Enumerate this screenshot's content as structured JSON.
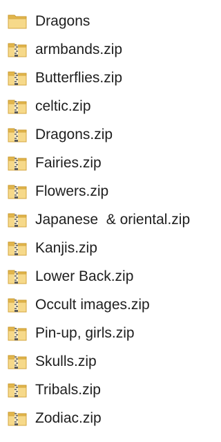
{
  "folder_view": {
    "items": [
      {
        "name": "Dragons",
        "type": "folder",
        "icon": "folder-icon"
      },
      {
        "name": "armbands.zip",
        "type": "zip",
        "icon": "zip-folder-icon"
      },
      {
        "name": "Butterflies.zip",
        "type": "zip",
        "icon": "zip-folder-icon"
      },
      {
        "name": "celtic.zip",
        "type": "zip",
        "icon": "zip-folder-icon"
      },
      {
        "name": "Dragons.zip",
        "type": "zip",
        "icon": "zip-folder-icon"
      },
      {
        "name": "Fairies.zip",
        "type": "zip",
        "icon": "zip-folder-icon"
      },
      {
        "name": "Flowers.zip",
        "type": "zip",
        "icon": "zip-folder-icon"
      },
      {
        "name": "Japanese  & oriental.zip",
        "type": "zip",
        "icon": "zip-folder-icon"
      },
      {
        "name": "Kanjis.zip",
        "type": "zip",
        "icon": "zip-folder-icon"
      },
      {
        "name": "Lower Back.zip",
        "type": "zip",
        "icon": "zip-folder-icon"
      },
      {
        "name": "Occult images.zip",
        "type": "zip",
        "icon": "zip-folder-icon"
      },
      {
        "name": "Pin-up, girls.zip",
        "type": "zip",
        "icon": "zip-folder-icon"
      },
      {
        "name": "Skulls.zip",
        "type": "zip",
        "icon": "zip-folder-icon"
      },
      {
        "name": "Tribals.zip",
        "type": "zip",
        "icon": "zip-folder-icon"
      },
      {
        "name": "Zodiac.zip",
        "type": "zip",
        "icon": "zip-folder-icon"
      }
    ]
  },
  "colors": {
    "text": "#1e1e1e",
    "folder_light": "#f6d98a",
    "folder_dark": "#e2b64c",
    "zipper": "#7a7a7a"
  }
}
